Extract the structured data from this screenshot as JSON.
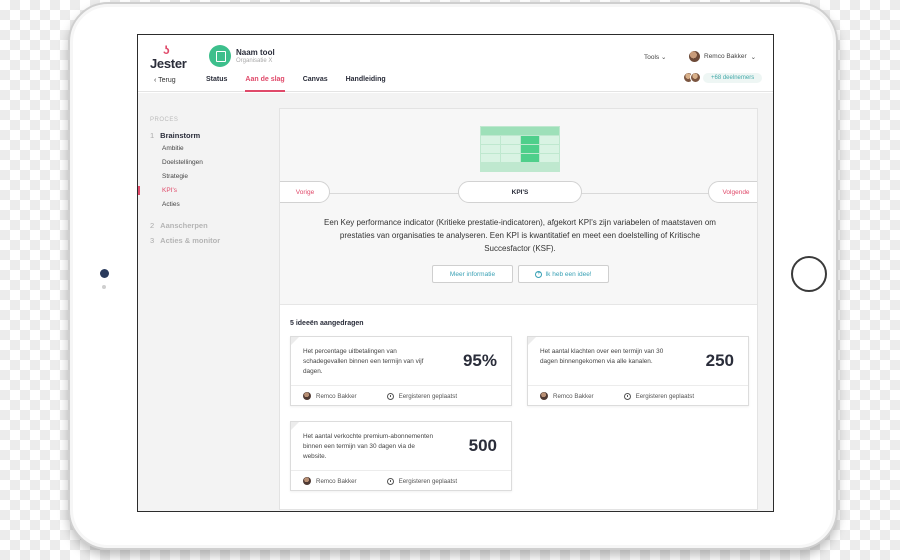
{
  "app": {
    "logo_text": "Jester",
    "back_label": "Terug",
    "tool_name": "Naam tool",
    "organisation": "Organisatie X",
    "tabs": [
      {
        "label": "Status",
        "active": false
      },
      {
        "label": "Aan de slag",
        "active": true
      },
      {
        "label": "Canvas",
        "active": false
      },
      {
        "label": "Handleiding",
        "active": false
      }
    ],
    "tools_menu": "Tools",
    "user_name": "Remco Bakker",
    "participants_badge": "+68 deelnemers",
    "accent_color": "#e04a6a",
    "secondary_color": "#3aa1b5"
  },
  "sidebar": {
    "section_label": "PROCES",
    "steps": [
      {
        "num": "1",
        "label": "Brainstorm",
        "active": true
      },
      {
        "num": "2",
        "label": "Aanscherpen",
        "active": false
      },
      {
        "num": "3",
        "label": "Acties & monitor",
        "active": false
      }
    ],
    "substeps": [
      {
        "label": "Ambitie",
        "active": false
      },
      {
        "label": "Doelstellingen",
        "active": false
      },
      {
        "label": "Strategie",
        "active": false
      },
      {
        "label": "KPI's",
        "active": true
      },
      {
        "label": "Acties",
        "active": false
      }
    ]
  },
  "hero": {
    "prev_label": "Vorige",
    "current_label": "KPI'S",
    "next_label": "Volgende",
    "description": "Een Key performance indicator (Kritieke prestatie-indicatoren), afgekort KPI's zijn variabelen of maatstaven om prestaties van organisaties te analyseren. Een KPI is kwantitatief en meet een doelstelling of Kritische Succesfactor (KSF).",
    "more_info_button": "Meer informatie",
    "idea_button": "Ik heb een idee!"
  },
  "ideas": {
    "title": "5 ideeën aangedragen",
    "cards": [
      {
        "text": "Het percentage uitbetalingen van schadegevallen binnen een termijn van vijf dagen.",
        "value": "95%",
        "author": "Remco Bakker",
        "time": "Eergisteren geplaatst"
      },
      {
        "text": "Het aantal klachten over een termijn van 30 dagen binnengekomen via alle kanalen.",
        "value": "250",
        "author": "Remco Bakker",
        "time": "Eergisteren geplaatst"
      },
      {
        "text": "Het aantal verkochte premium-abonnementen binnen een termijn van 30 dagen via de website.",
        "value": "500",
        "author": "Remco Bakker",
        "time": "Eergisteren geplaatst"
      }
    ]
  }
}
